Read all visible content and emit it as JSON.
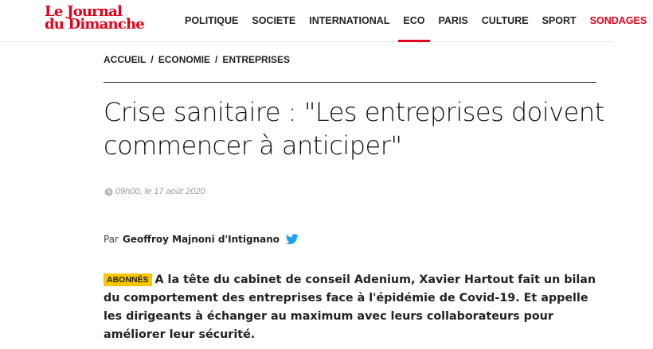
{
  "header": {
    "logo_line1": "Le Journal",
    "logo_line2": "du Dimanche",
    "nav": [
      {
        "label": "POLITIQUE"
      },
      {
        "label": "SOCIETE"
      },
      {
        "label": "INTERNATIONAL"
      },
      {
        "label": "ECO",
        "active": true
      },
      {
        "label": "PARIS"
      },
      {
        "label": "CULTURE"
      },
      {
        "label": "SPORT"
      },
      {
        "label": "SONDAGES"
      }
    ],
    "active_color": "#e3001b"
  },
  "breadcrumb": {
    "items": [
      "ACCUEIL",
      "ECONOMIE",
      "ENTREPRISES"
    ],
    "separator": "/"
  },
  "article": {
    "title": "Crise sanitaire : \"Les entreprises doivent commencer à anticiper\"",
    "time": "09h00",
    "date": ", le 17 août 2020",
    "byline_prefix": "Par",
    "author": "Geoffroy Majnoni d'Intignano",
    "badge": "ABONNÉS",
    "lead": "A la tête du cabinet de conseil Adenium, Xavier Hartout fait un bilan du comportement des entreprises face à l'épidémie de Covid-19. Et appelle les dirigeants à échanger au maximum avec leurs collaborateurs pour améliorer leur sécurité."
  },
  "icons": {
    "clock": "clock-icon",
    "twitter": "twitter-icon"
  },
  "colors": {
    "brand_red": "#e3001b",
    "badge_yellow": "#f6c600",
    "twitter_blue": "#1da1f2"
  }
}
